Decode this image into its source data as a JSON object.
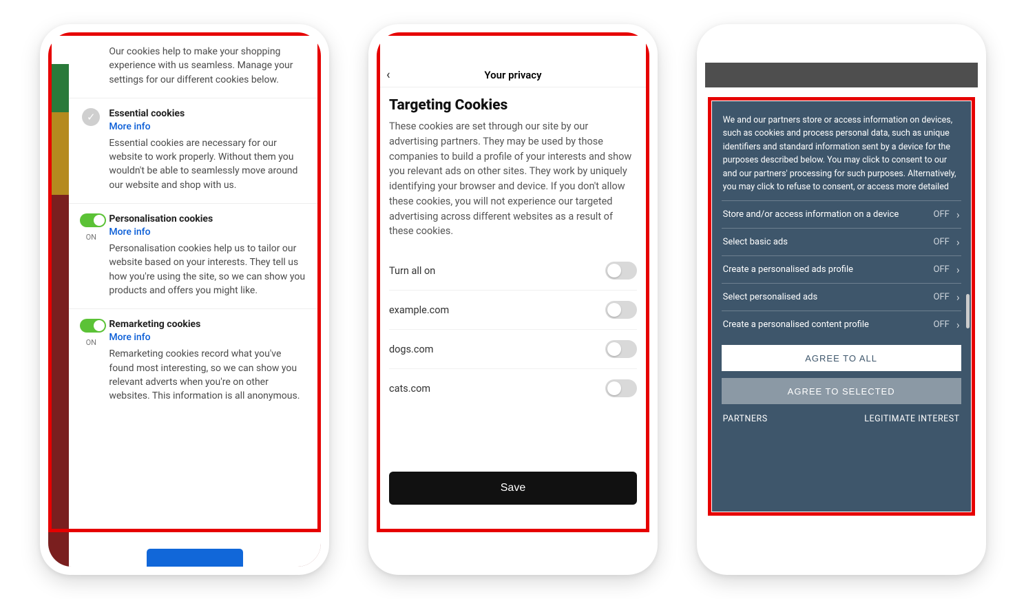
{
  "phone1": {
    "intro": "Our cookies help to make your shopping experience with us seamless. Manage your settings for our different cookies below.",
    "sections": [
      {
        "title": "Essential cookies",
        "more": "More info",
        "desc": "Essential cookies are necessary for our website to work properly. Without them you wouldn't be able to seamlessly move around our website and shop with us.",
        "locked": true
      },
      {
        "title": "Personalisation cookies",
        "more": "More info",
        "desc": "Personalisation cookies help us to tailor our website based on your interests. They tell us how you're using the site, so we can show you products and offers you might like.",
        "state_label": "ON"
      },
      {
        "title": "Remarketing cookies",
        "more": "More info",
        "desc": "Remarketing cookies record what you've found most interesting, so we can show you relevant adverts when you're on other websites. This information is all anonymous.",
        "state_label": "ON"
      }
    ]
  },
  "phone2": {
    "header": "Your privacy",
    "heading": "Targeting Cookies",
    "paragraph": "These cookies are set through our site by our advertising partners. They may be used by those companies to build a profile of your interests and show you relevant ads on other sites. They work by uniquely identifying your browser and device. If you don't allow these cookies, you will not experience our targeted advertising across different websites as a result of these cookies.",
    "turn_all": "Turn all on",
    "items": [
      "example.com",
      "dogs.com",
      "cats.com"
    ],
    "save": "Save"
  },
  "phone3": {
    "intro": "We and our partners store or access information on devices, such as cookies and process personal data, such as unique identifiers and standard information sent by a device for the purposes described below. You may click to consent to our and our partners' processing for such purposes. Alternatively, you may click to refuse to consent, or access more detailed",
    "off": "OFF",
    "items": [
      "Store and/or access information on a device",
      "Select basic ads",
      "Create a personalised ads profile",
      "Select personalised ads",
      "Create a personalised content profile"
    ],
    "agree_all": "AGREE TO ALL",
    "agree_selected": "AGREE TO SELECTED",
    "partners": "PARTNERS",
    "legit": "LEGITIMATE INTEREST"
  }
}
